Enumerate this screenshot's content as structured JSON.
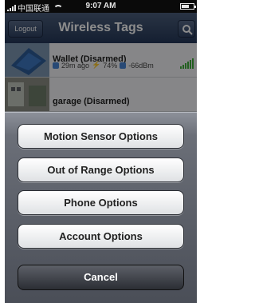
{
  "status_bar": {
    "carrier": "中国联通",
    "time": "9:07 AM"
  },
  "nav": {
    "logout_label": "Logout",
    "title": "Wireless Tags"
  },
  "tags": [
    {
      "name": "Wallet (Disarmed)",
      "last_update": "29m ago",
      "battery": "74%",
      "signal": "-66dBm"
    },
    {
      "name": "garage (Disarmed)"
    }
  ],
  "action_sheet": {
    "options": [
      "Motion Sensor Options",
      "Out of Range Options",
      "Phone Options",
      "Account Options"
    ],
    "cancel_label": "Cancel"
  }
}
